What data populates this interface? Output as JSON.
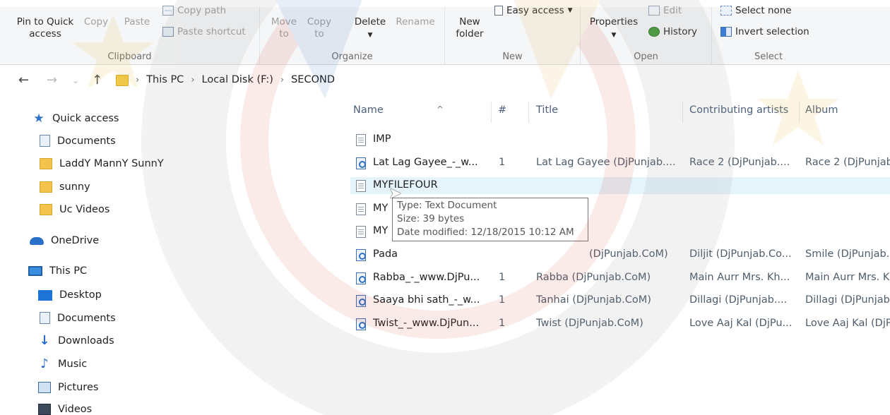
{
  "ribbon": {
    "clipboard": {
      "label": "Clipboard",
      "pin_label": "Pin to Quick\naccess",
      "copy_label": "Copy",
      "paste_label": "Paste",
      "copy_path_label": "Copy path",
      "paste_shortcut_label": "Paste shortcut"
    },
    "organize": {
      "label": "Organize",
      "move_to_label": "Move\nto",
      "copy_to_label": "Copy\nto",
      "delete_label": "Delete",
      "rename_label": "Rename"
    },
    "new": {
      "label": "New",
      "new_folder_label": "New\nfolder",
      "easy_access_label": "Easy access"
    },
    "open": {
      "label": "Open",
      "properties_label": "Properties",
      "edit_label": "Edit",
      "history_label": "History"
    },
    "select": {
      "label": "Select",
      "select_none_label": "Select none",
      "invert_selection_label": "Invert selection"
    }
  },
  "address": {
    "crumbs": [
      "This PC",
      "Local Disk (F:)",
      "SECOND"
    ]
  },
  "nav": {
    "quick_access": "Quick access",
    "quick_items": [
      "Documents",
      "LaddY MannY SunnY",
      "sunny",
      "Uc Videos"
    ],
    "onedrive": "OneDrive",
    "this_pc": "This PC",
    "pc_items": [
      "Desktop",
      "Documents",
      "Downloads",
      "Music",
      "Pictures",
      "Videos"
    ]
  },
  "columns": {
    "name": "Name",
    "number": "#",
    "title": "Title",
    "artists": "Contributing artists",
    "album": "Album"
  },
  "files": [
    {
      "name": "IMP",
      "num": "",
      "title": "",
      "artists": "",
      "album": "",
      "type": "txt"
    },
    {
      "name": "Lat Lag Gayee_-_w...",
      "num": "1",
      "title": "Lat Lag Gayee (DjPunjab....",
      "artists": "Race 2 (DjPunjab....",
      "album": "Race 2 (DjPunjab",
      "type": "audio"
    },
    {
      "name": "MYFILEFOUR",
      "num": "",
      "title": "",
      "artists": "",
      "album": "",
      "type": "txt"
    },
    {
      "name": "MY",
      "num": "",
      "title": "",
      "artists": "",
      "album": "",
      "type": "txt"
    },
    {
      "name": "MY",
      "num": "",
      "title": "",
      "artists": "",
      "album": "",
      "type": "txt"
    },
    {
      "name": "Pada",
      "num": "",
      "title": "(DjPunjab.CoM)",
      "artists": "Diljit (DjPunjab.Co...",
      "album": "Smile (DjPunjab.",
      "type": "audio"
    },
    {
      "name": "Rabba_-_www.DjPu...",
      "num": "1",
      "title": "Rabba (DjPunjab.CoM)",
      "artists": "Main Aurr Mrs. Kh...",
      "album": "Main Aurr Mrs. K",
      "type": "audio"
    },
    {
      "name": "Saaya bhi sath_-_w...",
      "num": "1",
      "title": "Tanhai (DjPunjab.CoM)",
      "artists": "Dillagi (DjPunjab....",
      "album": "Dillagi (DjPunjab",
      "type": "audio"
    },
    {
      "name": "Twist_-_www.DjPun...",
      "num": "1",
      "title": "Twist (DjPunjab.CoM)",
      "artists": "Love Aaj Kal (DjPu...",
      "album": "Love Aaj Kal (DjP",
      "type": "audio"
    }
  ],
  "tooltip": {
    "type": "Type: Text Document",
    "size": "Size: 39 bytes",
    "modified": "Date modified: 12/18/2015 10:12 AM"
  },
  "colors": {
    "ribbon_bg": "#f5f6f7",
    "hover_row": "#e5f3fb",
    "accent": "#2d73c8"
  }
}
